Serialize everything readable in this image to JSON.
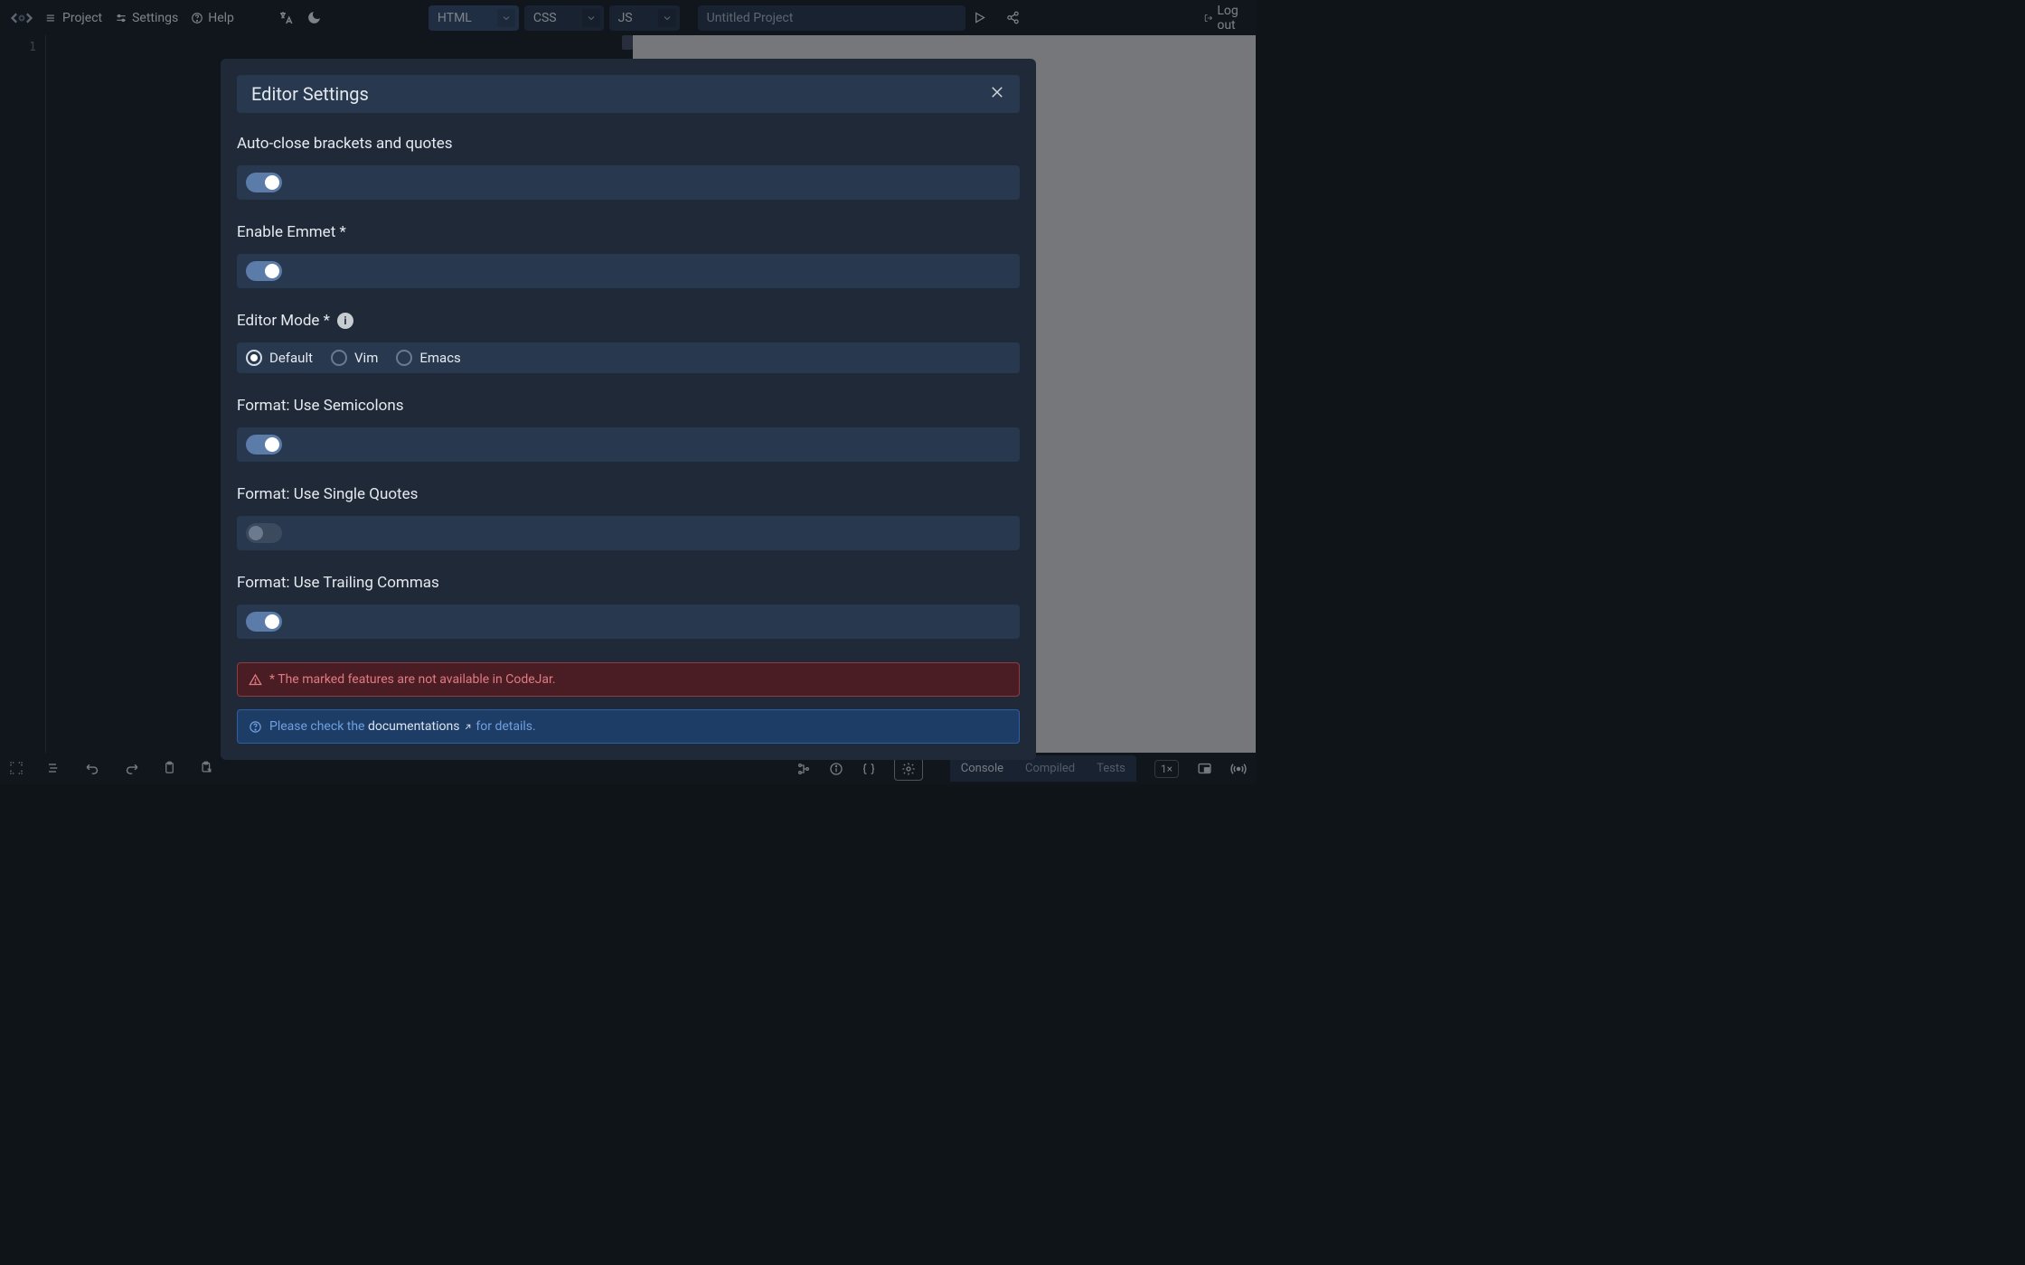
{
  "topbar": {
    "menu": {
      "project": "Project",
      "settings": "Settings",
      "help": "Help"
    },
    "langTabs": [
      {
        "label": "HTML",
        "active": true
      },
      {
        "label": "CSS",
        "active": false
      },
      {
        "label": "JS",
        "active": false
      }
    ],
    "projectTitle": "Untitled Project",
    "logout": "Log out"
  },
  "editor": {
    "lineNumbers": [
      "1"
    ]
  },
  "modal": {
    "title": "Editor Settings",
    "settings": [
      {
        "label": "Auto-close brackets and quotes",
        "type": "toggle",
        "value": true
      },
      {
        "label": "Enable Emmet *",
        "type": "toggle",
        "value": true
      },
      {
        "label": "Editor Mode *",
        "type": "radio",
        "hasInfo": true,
        "options": [
          "Default",
          "Vim",
          "Emacs"
        ],
        "selected": "Default"
      },
      {
        "label": "Format: Use Semicolons",
        "type": "toggle",
        "value": true
      },
      {
        "label": "Format: Use Single Quotes",
        "type": "toggle",
        "value": false
      },
      {
        "label": "Format: Use Trailing Commas",
        "type": "toggle",
        "value": true
      }
    ],
    "warnText": "* The marked features are not available in CodeJar.",
    "infoPrefix": "Please check the ",
    "infoLink": "documentations",
    "infoSuffix": " for details."
  },
  "bottombar": {
    "tabs": [
      "Console",
      "Compiled",
      "Tests"
    ],
    "zoom": "1×"
  }
}
